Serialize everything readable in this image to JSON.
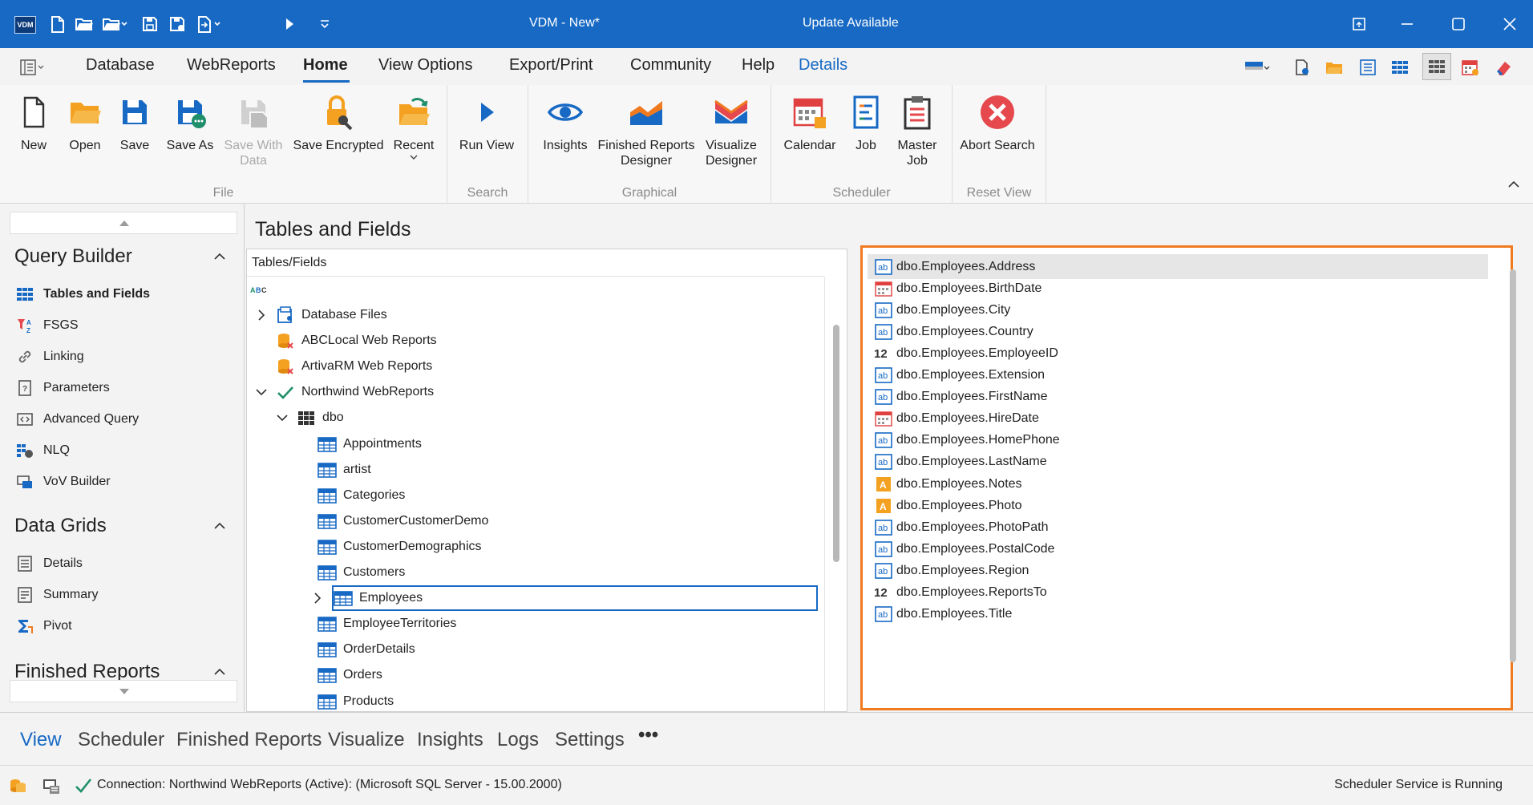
{
  "window": {
    "logo": "VDM",
    "title": "VDM - New*",
    "update_text": "Update Available",
    "accent": "#1769c4",
    "quick_access_icons": [
      "new-file-icon",
      "open-folder-icon",
      "open-dropdown-icon",
      "save-icon",
      "save-data-icon",
      "export-dropdown-icon",
      "run-icon",
      "customize-icon"
    ],
    "window_controls": [
      "restore-down-icon",
      "minimize-icon",
      "maximize-icon",
      "close-icon"
    ]
  },
  "menu": {
    "items": [
      "Database",
      "WebReports",
      "Home",
      "View Options",
      "Export/Print",
      "Community",
      "Help",
      "Details"
    ],
    "active": "Home",
    "right_icons": [
      "flag-dropdown-icon",
      "new-doc-icon",
      "folder-icon",
      "list-icon",
      "grid-icon",
      "grid-active-icon",
      "calendar-icon",
      "eraser-icon"
    ]
  },
  "ribbon": {
    "groups": [
      {
        "label": "File",
        "buttons": [
          {
            "label": "New",
            "icon": "new-file-icon"
          },
          {
            "label": "Open",
            "icon": "open-folder-icon"
          },
          {
            "label": "Save",
            "icon": "save-icon"
          },
          {
            "label": "Save As",
            "icon": "save-as-icon"
          },
          {
            "label": "Save With Data",
            "icon": "save-with-data-icon",
            "disabled": true
          },
          {
            "label": "Save Encrypted",
            "icon": "lock-key-icon"
          },
          {
            "label": "Recent",
            "icon": "recent-folder-icon",
            "dropdown": true
          }
        ]
      },
      {
        "label": "Search",
        "buttons": [
          {
            "label": "Run View",
            "icon": "run-icon"
          }
        ]
      },
      {
        "label": "Graphical",
        "buttons": [
          {
            "label": "Insights",
            "icon": "eye-icon"
          },
          {
            "label": "Finished Reports Designer",
            "icon": "area-chart-icon"
          },
          {
            "label": "Visualize Designer",
            "icon": "visualize-icon"
          }
        ]
      },
      {
        "label": "Scheduler",
        "buttons": [
          {
            "label": "Calendar",
            "icon": "calendar-icon"
          },
          {
            "label": "Job",
            "icon": "job-icon"
          },
          {
            "label": "Master Job",
            "icon": "clipboard-icon"
          }
        ]
      },
      {
        "label": "Reset View",
        "buttons": [
          {
            "label": "Abort Search",
            "icon": "abort-icon"
          }
        ]
      }
    ]
  },
  "sidebar": {
    "sections": [
      {
        "title": "Query Builder",
        "items": [
          {
            "label": "Tables and Fields",
            "icon": "table-grid-icon",
            "active": true
          },
          {
            "label": "FSGS",
            "icon": "sort-filter-icon"
          },
          {
            "label": "Linking",
            "icon": "link-icon"
          },
          {
            "label": "Parameters",
            "icon": "parameters-icon"
          },
          {
            "label": "Advanced Query",
            "icon": "code-icon"
          },
          {
            "label": "NLQ",
            "icon": "nlq-icon"
          },
          {
            "label": "VoV Builder",
            "icon": "vov-icon"
          }
        ]
      },
      {
        "title": "Data Grids",
        "items": [
          {
            "label": "Details",
            "icon": "details-icon"
          },
          {
            "label": "Summary",
            "icon": "summary-icon"
          },
          {
            "label": "Pivot",
            "icon": "pivot-icon"
          }
        ]
      },
      {
        "title": "Finished Reports",
        "items": []
      }
    ]
  },
  "main": {
    "title": "Tables and Fields",
    "tree_header": "Tables/Fields",
    "tree": [
      {
        "label": "Database Files",
        "level": 0,
        "expander": "collapsed",
        "icon": "database-files-icon"
      },
      {
        "label": "ABCLocal Web Reports",
        "level": 0,
        "expander": "none",
        "icon": "db-error-icon"
      },
      {
        "label": "ArtivaRM Web Reports",
        "level": 0,
        "expander": "none",
        "icon": "db-error-icon"
      },
      {
        "label": "Northwind WebReports",
        "level": 0,
        "expander": "expanded",
        "icon": "check-icon"
      },
      {
        "label": "dbo",
        "level": 1,
        "expander": "expanded",
        "icon": "schema-grid-icon"
      },
      {
        "label": "Appointments",
        "level": 2,
        "expander": "none",
        "icon": "table-icon"
      },
      {
        "label": "artist",
        "level": 2,
        "expander": "none",
        "icon": "table-icon"
      },
      {
        "label": "Categories",
        "level": 2,
        "expander": "none",
        "icon": "table-icon"
      },
      {
        "label": "CustomerCustomerDemo",
        "level": 2,
        "expander": "none",
        "icon": "table-icon"
      },
      {
        "label": "CustomerDemographics",
        "level": 2,
        "expander": "none",
        "icon": "table-icon"
      },
      {
        "label": "Customers",
        "level": 2,
        "expander": "none",
        "icon": "table-icon"
      },
      {
        "label": "Employees",
        "level": 2,
        "expander": "collapsed",
        "icon": "table-icon",
        "selected": true
      },
      {
        "label": "EmployeeTerritories",
        "level": 2,
        "expander": "none",
        "icon": "table-icon"
      },
      {
        "label": "OrderDetails",
        "level": 2,
        "expander": "none",
        "icon": "table-icon"
      },
      {
        "label": "Orders",
        "level": 2,
        "expander": "none",
        "icon": "table-icon"
      },
      {
        "label": "Products",
        "level": 2,
        "expander": "none",
        "icon": "table-icon"
      }
    ],
    "fields": [
      {
        "label": "dbo.Employees.Address",
        "type": "text",
        "highlighted": true
      },
      {
        "label": "dbo.Employees.BirthDate",
        "type": "date"
      },
      {
        "label": "dbo.Employees.City",
        "type": "text"
      },
      {
        "label": "dbo.Employees.Country",
        "type": "text"
      },
      {
        "label": "dbo.Employees.EmployeeID",
        "type": "number"
      },
      {
        "label": "dbo.Employees.Extension",
        "type": "text"
      },
      {
        "label": "dbo.Employees.FirstName",
        "type": "text"
      },
      {
        "label": "dbo.Employees.HireDate",
        "type": "date"
      },
      {
        "label": "dbo.Employees.HomePhone",
        "type": "text"
      },
      {
        "label": "dbo.Employees.LastName",
        "type": "text"
      },
      {
        "label": "dbo.Employees.Notes",
        "type": "memo"
      },
      {
        "label": "dbo.Employees.Photo",
        "type": "memo"
      },
      {
        "label": "dbo.Employees.PhotoPath",
        "type": "text"
      },
      {
        "label": "dbo.Employees.PostalCode",
        "type": "text"
      },
      {
        "label": "dbo.Employees.Region",
        "type": "text"
      },
      {
        "label": "dbo.Employees.ReportsTo",
        "type": "number"
      },
      {
        "label": "dbo.Employees.Title",
        "type": "text"
      }
    ],
    "number_glyph": "12",
    "memo_glyph": "A",
    "text_glyph": "ab",
    "highlight_color": "#f07a20"
  },
  "bottom_nav": {
    "items": [
      "View",
      "Scheduler",
      "Finished Reports",
      "Visualize",
      "Insights",
      "Logs",
      "Settings"
    ],
    "active": "View",
    "more": "•••"
  },
  "status": {
    "connection": "Connection: Northwind WebReports (Active): (Microsoft SQL Server - 15.00.2000)",
    "scheduler": "Scheduler Service is Running"
  }
}
